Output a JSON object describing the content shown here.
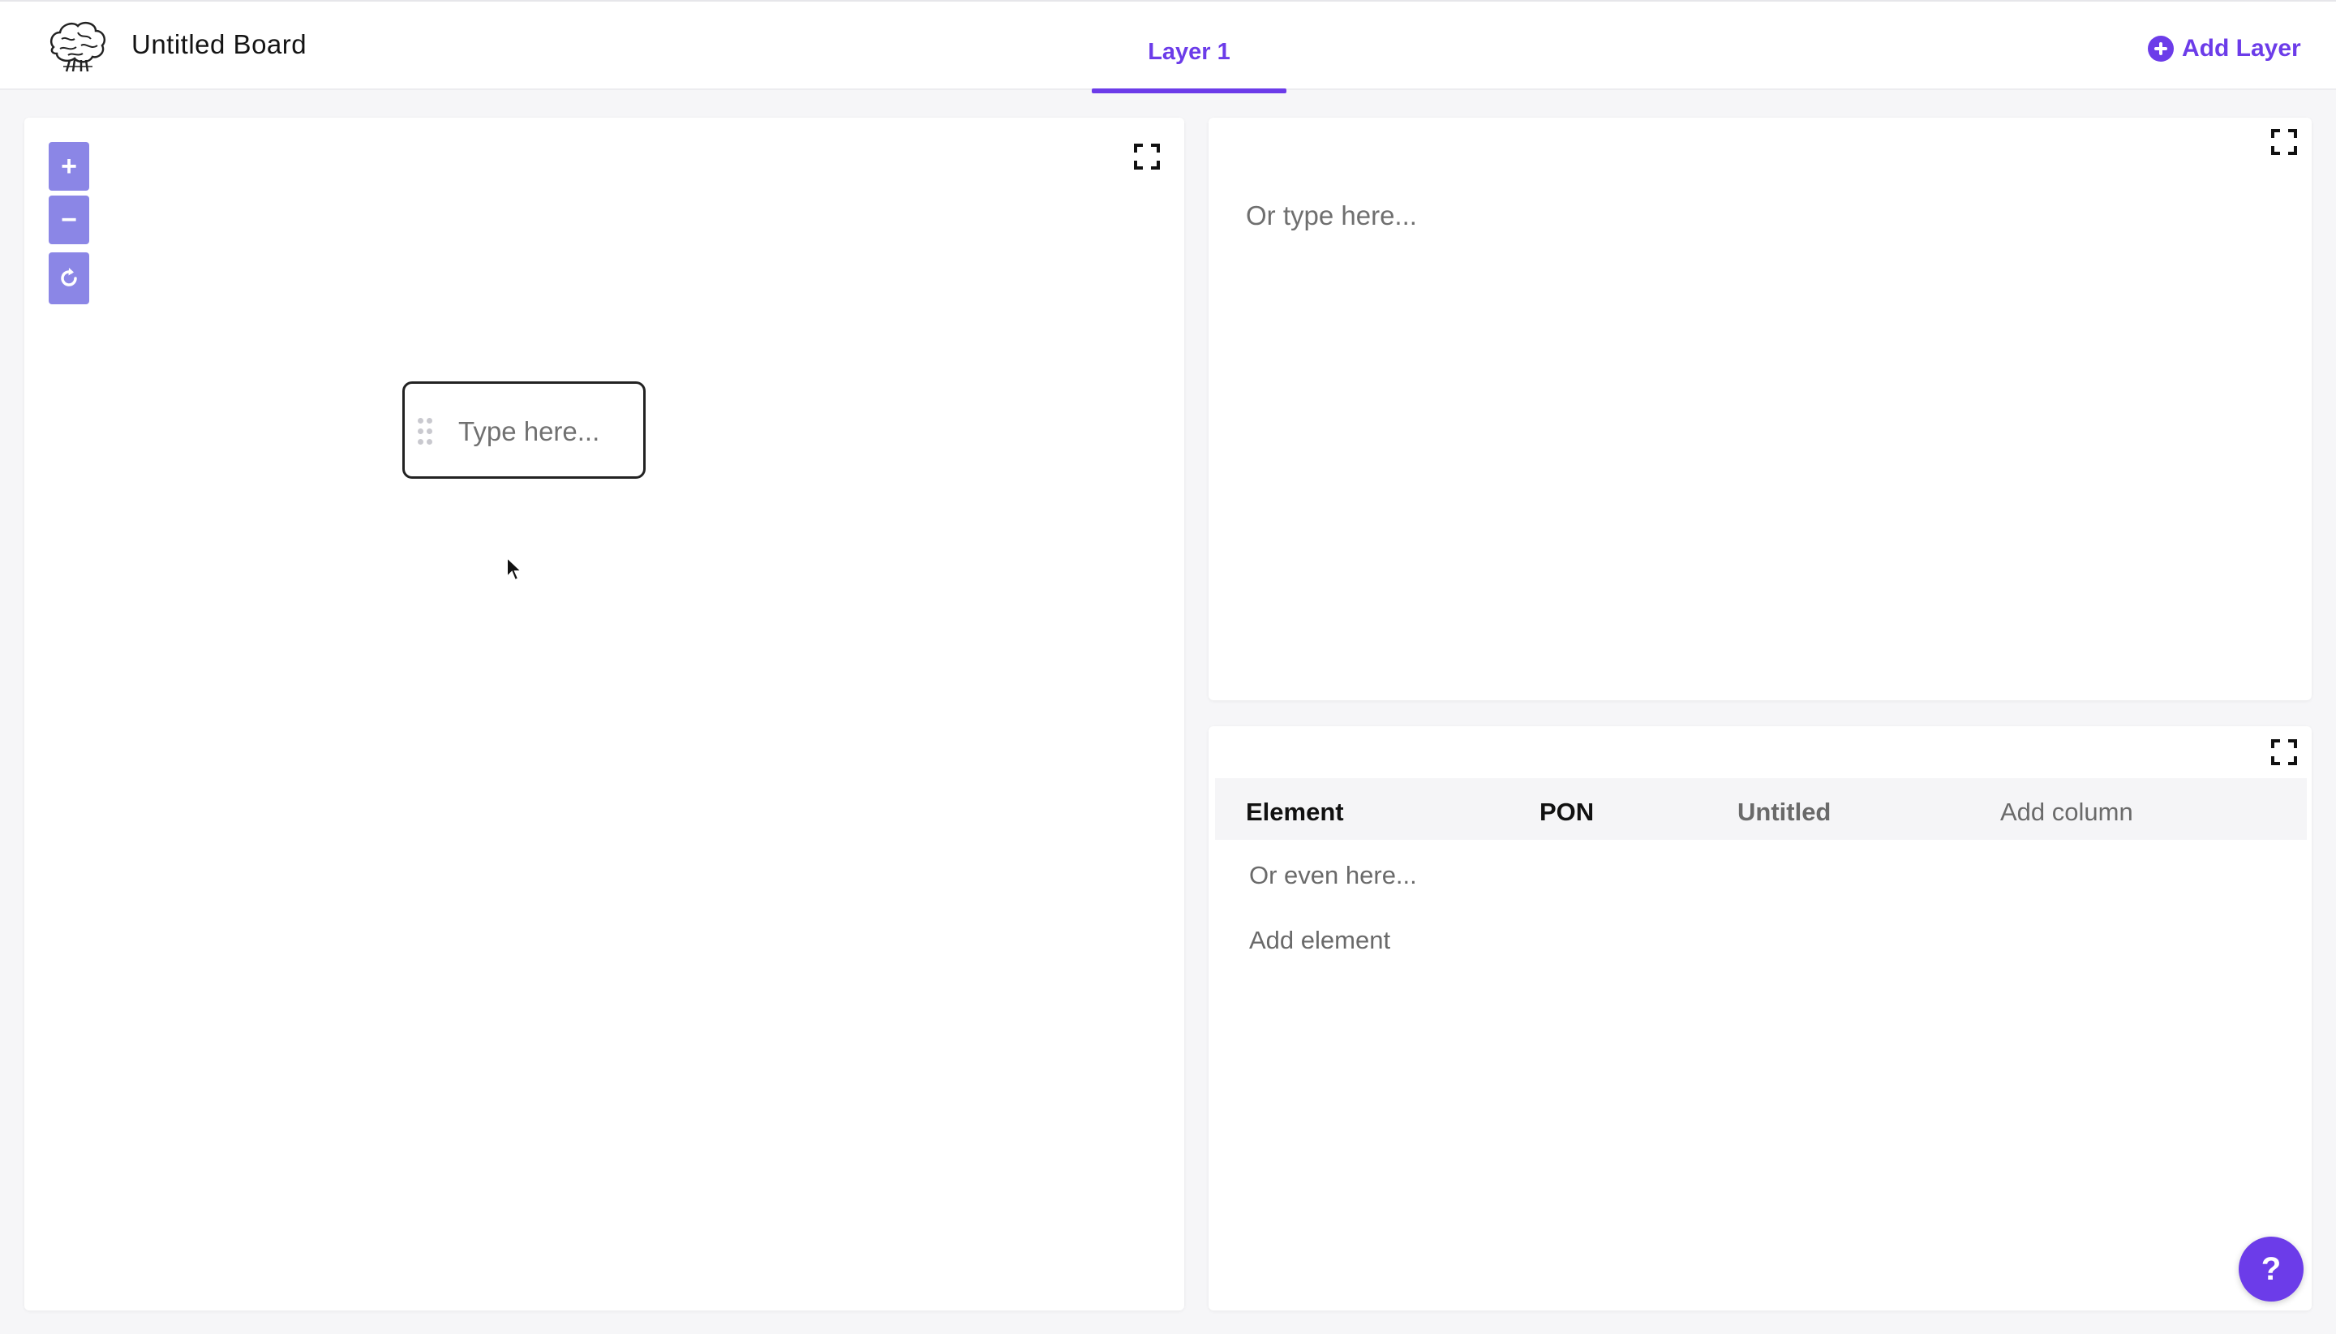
{
  "app": {
    "board_title": "Untitled Board",
    "logo_icon": "brain-logo-icon"
  },
  "tabs": [
    {
      "label": "Layer 1",
      "active": true
    }
  ],
  "add_layer": {
    "label": "Add Layer",
    "icon": "plus-circle-icon"
  },
  "canvas": {
    "zoom_in_label": "+",
    "zoom_out_label": "−",
    "reset_icon": "refresh-icon",
    "expand_icon": "expand-icon",
    "node": {
      "placeholder": "Type here...",
      "handle_icon": "drag-handle-icon"
    }
  },
  "text_panel": {
    "placeholder": "Or type here...",
    "expand_icon": "expand-icon"
  },
  "table": {
    "expand_icon": "expand-icon",
    "columns": [
      "Element",
      "PON",
      "Untitled"
    ],
    "add_column_label": "Add column",
    "rows": [
      {
        "placeholder": "Or even here..."
      }
    ],
    "add_element_label": "Add element"
  },
  "help": {
    "label": "?"
  },
  "colors": {
    "accent": "#6c3ce9",
    "zoom_button": "#8b86e6",
    "background": "#f6f6f8"
  }
}
